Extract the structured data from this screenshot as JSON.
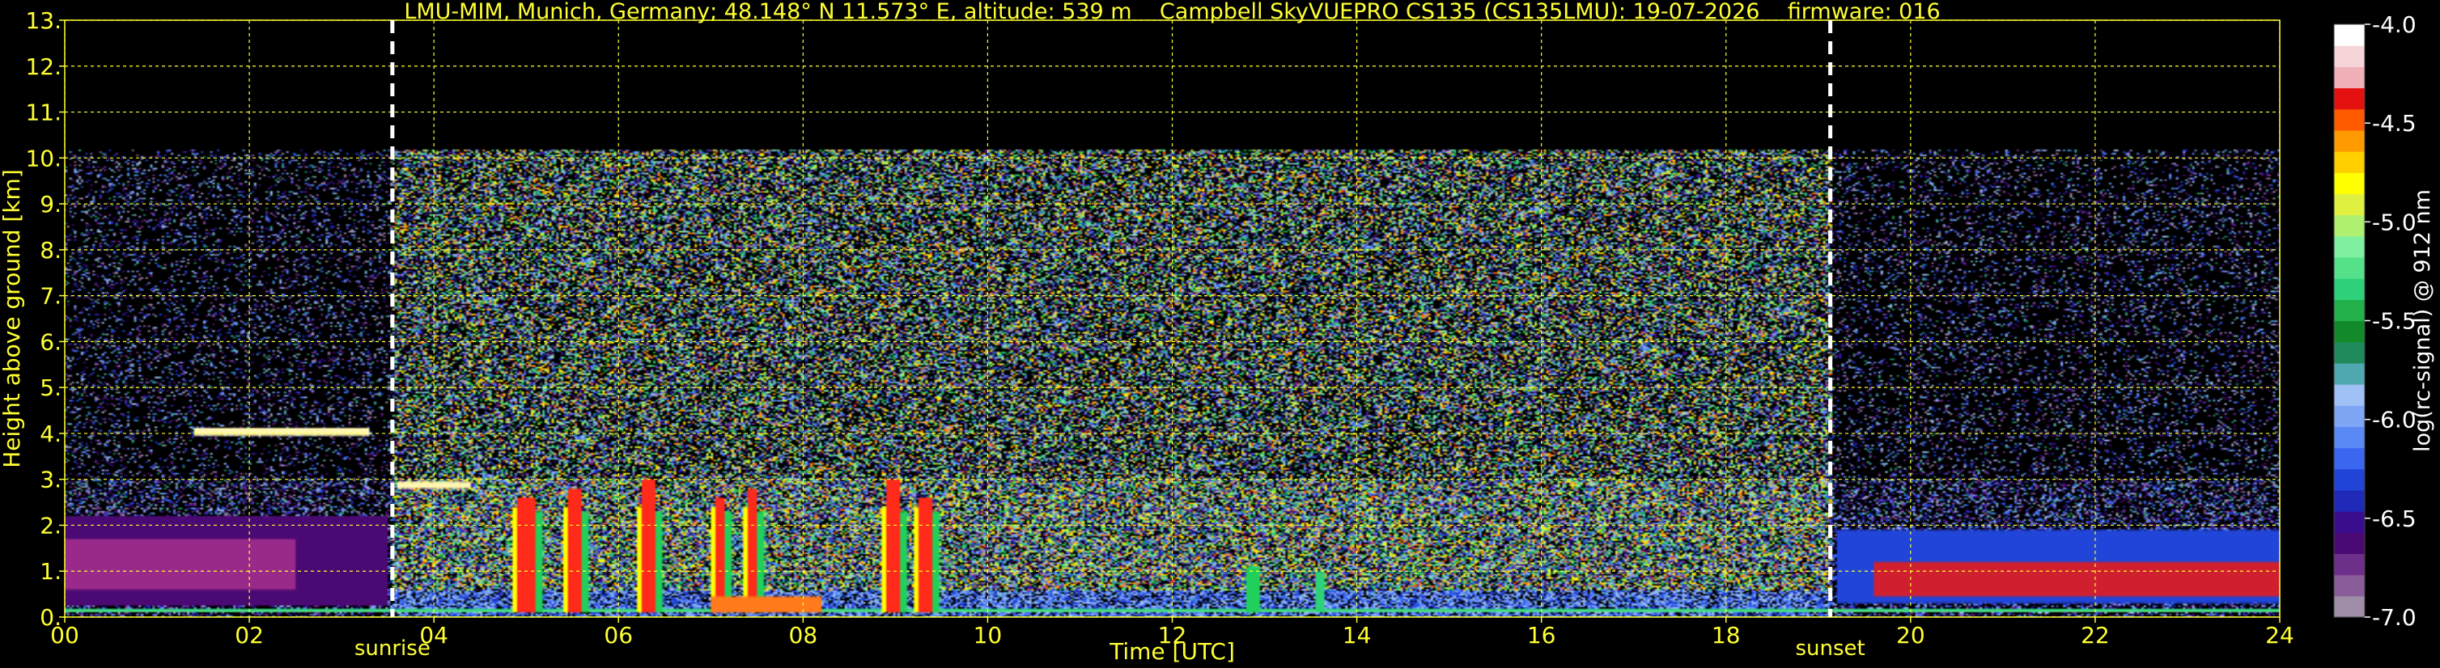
{
  "colors": {
    "background": "#000000",
    "text": "#ffff33",
    "cbar_text": "#ffffff",
    "grid": "#ffff33",
    "marker_lines": "#ffffff"
  },
  "chart_data": {
    "type": "heatmap",
    "title": "LMU-MIM, Munich, Germany; 48.148° N 11.573° E, altitude: 539 m    Campbell SkyVUEPRO CS135 (CS135LMU): 19-07-2026    firmware: 016",
    "xlabel": "Time [UTC]",
    "ylabel": "Height above ground [km]",
    "xlim": [
      0,
      24
    ],
    "ylim": [
      0,
      13
    ],
    "xticks": [
      0,
      2,
      4,
      6,
      8,
      10,
      12,
      14,
      16,
      18,
      20,
      22,
      24
    ],
    "xtick_labels": [
      "00",
      "02",
      "04",
      "06",
      "08",
      "10",
      "12",
      "14",
      "16",
      "18",
      "20",
      "22",
      "24"
    ],
    "yticks": [
      0,
      1,
      2,
      3,
      4,
      5,
      6,
      7,
      8,
      9,
      10,
      11,
      12,
      13
    ],
    "ytick_labels": [
      "0.",
      "1.",
      "2.",
      "3.",
      "4.",
      "5.",
      "6.",
      "7.",
      "8.",
      "9.",
      "10.",
      "11.",
      "12.",
      "13."
    ],
    "grid": true,
    "markers": [
      {
        "label": "sunrise",
        "x": 3.55
      },
      {
        "label": "sunset",
        "x": 19.13
      }
    ],
    "colorbar": {
      "label": "log(rc-signal) @ 912 nm",
      "range": [
        -7.0,
        -4.0
      ],
      "ticks": [
        -7.0,
        -6.5,
        -6.0,
        -5.5,
        -5.0,
        -4.5,
        -4.0
      ],
      "tick_labels": [
        "-7.0",
        "-6.5",
        "-6.0",
        "-5.5",
        "-5.0",
        "-4.5",
        "-4.0"
      ],
      "colors": [
        "#a08ea8",
        "#8a5c9a",
        "#6e2f8a",
        "#4b0a73",
        "#3a0d8f",
        "#1f2ab8",
        "#2045d8",
        "#3a66f0",
        "#5a88f5",
        "#7ea6f5",
        "#9fc1f5",
        "#4fa8b0",
        "#1f8a5a",
        "#138a2a",
        "#21b04a",
        "#2ed17a",
        "#55e08a",
        "#7ff0a0",
        "#b0f070",
        "#e0f040",
        "#ffff00",
        "#ffcf00",
        "#ff9a00",
        "#ff5a00",
        "#e51010",
        "#f0b0b8",
        "#f5d5d8",
        "#ffffff"
      ]
    }
  }
}
